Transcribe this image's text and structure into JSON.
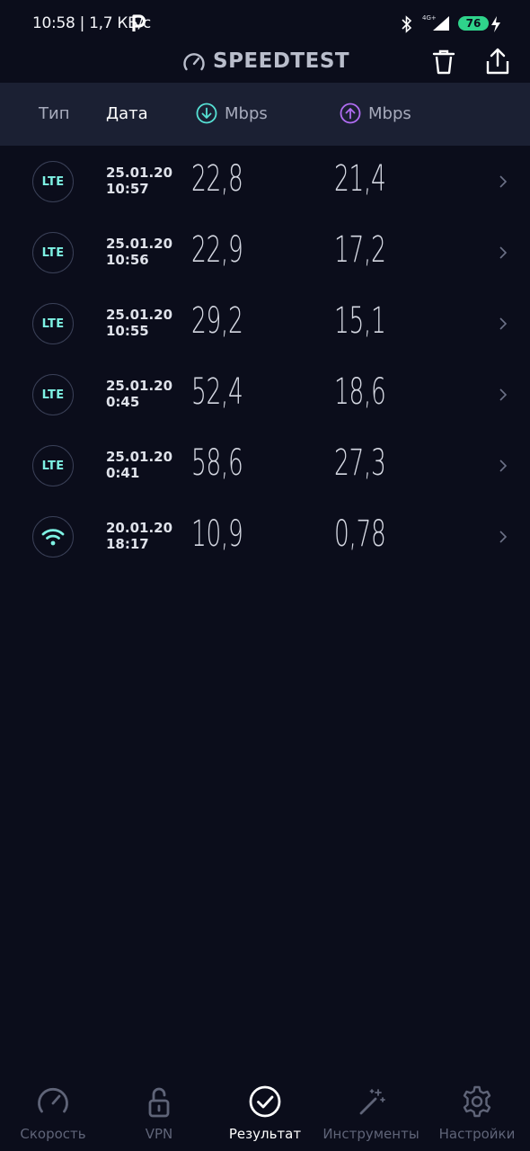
{
  "status_bar": {
    "time": "10:58 | 1,7 КБ/с",
    "network_type": "4G+",
    "battery": "76"
  },
  "app_bar": {
    "title": "SPEEDTEST"
  },
  "table_header": {
    "type_label": "Тип",
    "date_label": "Дата",
    "download_label": "Mbps",
    "upload_label": "Mbps"
  },
  "results": [
    {
      "type": "LTE",
      "date": "25.01.20",
      "time": "10:57",
      "download": "22,8",
      "upload": "21,4"
    },
    {
      "type": "LTE",
      "date": "25.01.20",
      "time": "10:56",
      "download": "22,9",
      "upload": "17,2"
    },
    {
      "type": "LTE",
      "date": "25.01.20",
      "time": "10:55",
      "download": "29,2",
      "upload": "15,1"
    },
    {
      "type": "LTE",
      "date": "25.01.20",
      "time": "0:45",
      "download": "52,4",
      "upload": "18,6"
    },
    {
      "type": "LTE",
      "date": "25.01.20",
      "time": "0:41",
      "download": "58,6",
      "upload": "27,3"
    },
    {
      "type": "wifi",
      "date": "20.01.20",
      "time": "18:17",
      "download": "10,9",
      "upload": "0,78"
    }
  ],
  "bottom_nav": {
    "speed": "Скорость",
    "vpn": "VPN",
    "results": "Результат",
    "tools": "Инструменты",
    "settings": "Настройки"
  },
  "colors": {
    "background": "#0b0d1b",
    "header_bg": "#1b2033",
    "download_accent": "#56e0d4",
    "upload_accent": "#b06cf2",
    "lte_text": "#7ef2e4",
    "battery": "#2fd38b"
  },
  "icons": {
    "p_notification": "p-icon",
    "bluetooth": "bluetooth-icon",
    "signal": "signal-icon",
    "charging": "charging-icon",
    "gauge": "gauge-icon",
    "trash": "trash-icon",
    "share": "share-icon",
    "download": "download-arrow-icon",
    "upload": "upload-arrow-icon",
    "wifi": "wifi-icon",
    "chevron": "chevron-right-icon"
  }
}
